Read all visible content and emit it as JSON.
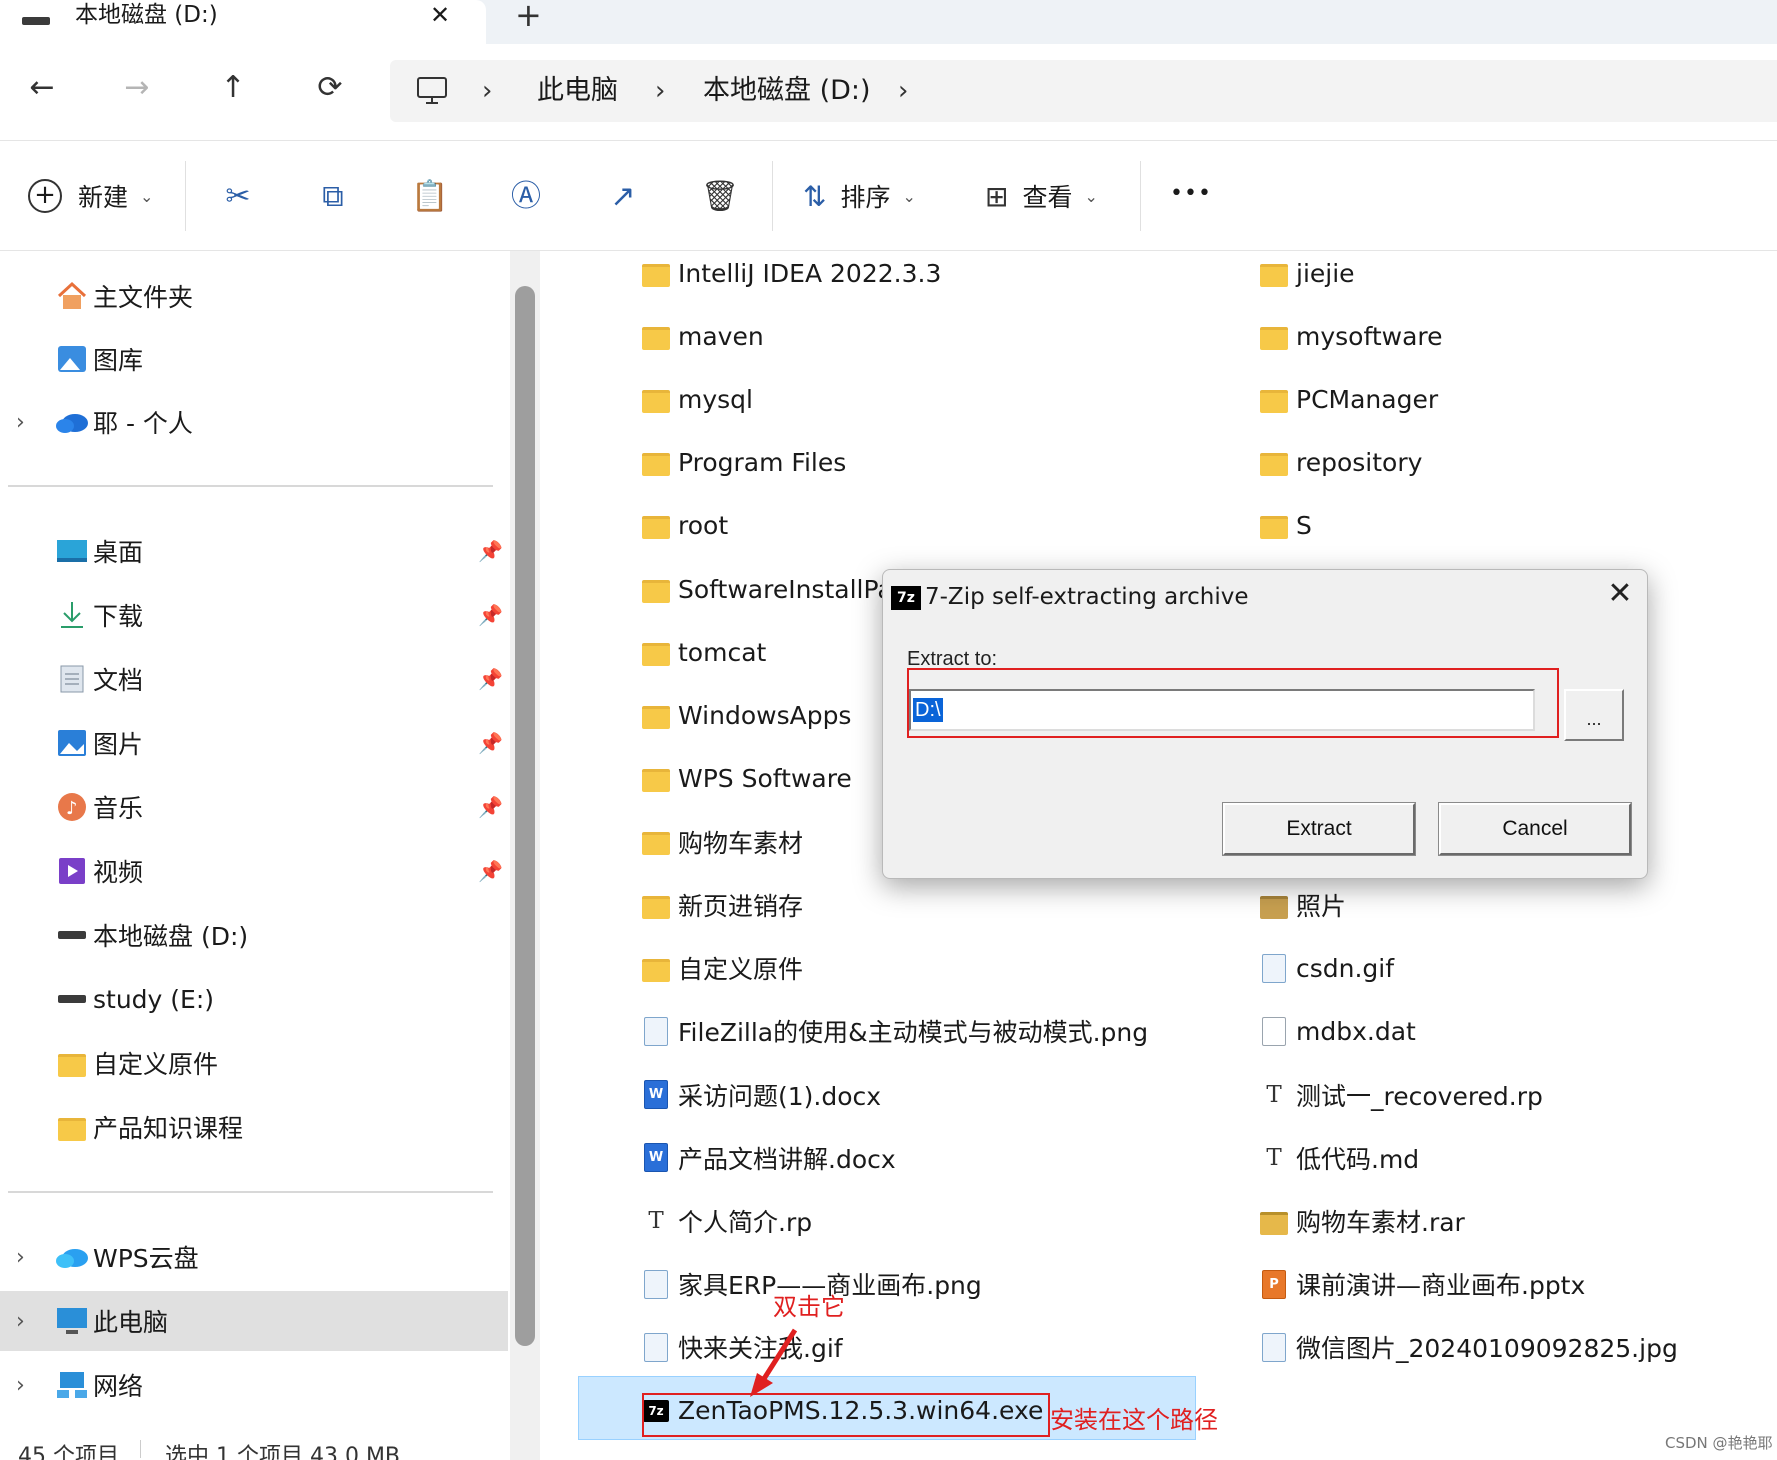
{
  "window": {
    "tab_title": "本地磁盘 (D:)",
    "tab_close": "✕",
    "new_tab": "+"
  },
  "nav": {
    "back": "←",
    "forward": "→",
    "up": "↑",
    "refresh": "⟳",
    "breadcrumb": [
      "此电脑",
      "本地磁盘 (D:)"
    ],
    "sep": "›"
  },
  "toolbar": {
    "new_label": "新建",
    "sort_label": "排序",
    "view_label": "查看",
    "more": "•••"
  },
  "sidebar": {
    "top": [
      {
        "label": "主文件夹",
        "icon": "home-icon"
      },
      {
        "label": "图库",
        "icon": "gallery-icon"
      },
      {
        "label": "耶 - 个人",
        "icon": "onedrive-icon",
        "expandable": true
      }
    ],
    "pinned": [
      {
        "label": "桌面",
        "icon": "desktop-icon",
        "pinned": true
      },
      {
        "label": "下载",
        "icon": "download-icon",
        "pinned": true
      },
      {
        "label": "文档",
        "icon": "documents-icon",
        "pinned": true
      },
      {
        "label": "图片",
        "icon": "pictures-icon",
        "pinned": true
      },
      {
        "label": "音乐",
        "icon": "music-icon",
        "pinned": true
      },
      {
        "label": "视频",
        "icon": "videos-icon",
        "pinned": true
      },
      {
        "label": "本地磁盘 (D:)",
        "icon": "drive-icon"
      },
      {
        "label": "study (E:)",
        "icon": "drive-icon"
      },
      {
        "label": "自定义原件",
        "icon": "folder-icon"
      },
      {
        "label": "产品知识课程",
        "icon": "folder-icon"
      }
    ],
    "bottom": [
      {
        "label": "WPS云盘",
        "icon": "wps-cloud-icon",
        "expandable": true
      },
      {
        "label": "此电脑",
        "icon": "this-pc-icon",
        "expandable": true,
        "selected": true
      },
      {
        "label": "网络",
        "icon": "network-icon",
        "expandable": true
      }
    ]
  },
  "files_left": [
    {
      "name": "IntelliJ IDEA 2022.3.3",
      "type": "folder"
    },
    {
      "name": "maven",
      "type": "folder"
    },
    {
      "name": "mysql",
      "type": "folder"
    },
    {
      "name": "Program Files",
      "type": "folder"
    },
    {
      "name": "root",
      "type": "folder"
    },
    {
      "name": "SoftwareInstallPat",
      "type": "folder"
    },
    {
      "name": "tomcat",
      "type": "folder"
    },
    {
      "name": "WindowsApps",
      "type": "folder"
    },
    {
      "name": "WPS Software",
      "type": "folder"
    },
    {
      "name": "购物车素材",
      "type": "folder"
    },
    {
      "name": "新页进销存",
      "type": "folder"
    },
    {
      "name": "自定义原件",
      "type": "folder"
    },
    {
      "name": "FileZilla的使用&主动模式与被动模式.png",
      "type": "png"
    },
    {
      "name": "采访问题(1).docx",
      "type": "docx"
    },
    {
      "name": "产品文档讲解.docx",
      "type": "docx"
    },
    {
      "name": "个人简介.rp",
      "type": "rp"
    },
    {
      "name": "家具ERP——商业画布.png",
      "type": "png"
    },
    {
      "name": "快来关注我.gif",
      "type": "gif"
    },
    {
      "name": "ZenTaoPMS.12.5.3.win64.exe",
      "type": "7z-exe"
    }
  ],
  "files_right": [
    {
      "name": "jiejie",
      "type": "folder"
    },
    {
      "name": "mysoftware",
      "type": "folder"
    },
    {
      "name": "PCManager",
      "type": "folder"
    },
    {
      "name": "repository",
      "type": "folder"
    },
    {
      "name": "S",
      "type": "folder"
    },
    {
      "name": "照片",
      "type": "folder-dark"
    },
    {
      "name": "csdn.gif",
      "type": "gif"
    },
    {
      "name": "mdbx.dat",
      "type": "dat"
    },
    {
      "name": "测试一_recovered.rp",
      "type": "rp"
    },
    {
      "name": "低代码.md",
      "type": "md"
    },
    {
      "name": "购物车素材.rar",
      "type": "rar"
    },
    {
      "name": "课前演讲—商业画布.pptx",
      "type": "pptx"
    },
    {
      "name": "微信图片_20240109092825.jpg",
      "type": "jpg"
    }
  ],
  "annotations": {
    "double_click": "双击它",
    "install_path": "安装在这个路径"
  },
  "dialog": {
    "logo": "7z",
    "title": "7-Zip self-extracting archive",
    "close": "✕",
    "extract_to_label": "Extract to:",
    "path_value": "D:\\",
    "browse_label": "...",
    "extract_button": "Extract",
    "cancel_button": "Cancel"
  },
  "status": {
    "items_count": "45 个项目",
    "selection": "选中 1 个项目  43.0 MB"
  },
  "watermark": "CSDN @艳艳耶",
  "colors": {
    "selection_bg": "#cce8ff",
    "annotation_red": "#e02020",
    "folder_yellow": "#f7c948",
    "dialog_bg": "#f0f0f0"
  }
}
